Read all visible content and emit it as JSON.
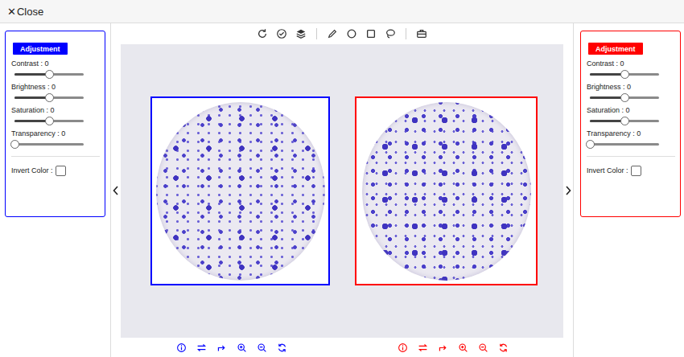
{
  "top_bar": {
    "close_icon": "✕",
    "close_label": "Close"
  },
  "panels": [
    {
      "color": "#0000ff",
      "button": "Adjustment",
      "controls": [
        {
          "kind": "slider",
          "label": "Contrast : 0",
          "level": 0.5
        },
        {
          "kind": "slider",
          "label": "Brightness : 0",
          "level": 0.5
        },
        {
          "kind": "slider",
          "label": "Saturation : 0",
          "level": 0.5
        },
        {
          "kind": "slider",
          "label": "Transparency : 0",
          "level": 0
        },
        {
          "kind": "checkbox",
          "label": "Invert Color :",
          "checked": false
        }
      ]
    },
    {
      "color": "#ff0000",
      "button": "Adjustment",
      "controls": [
        {
          "kind": "slider",
          "label": "Contrast : 0",
          "level": 0.5
        },
        {
          "kind": "slider",
          "label": "Brightness : 0",
          "level": 0.5
        },
        {
          "kind": "slider",
          "label": "Saturation : 0",
          "level": 0.5
        },
        {
          "kind": "slider",
          "label": "Transparency : 0",
          "level": 0
        },
        {
          "kind": "checkbox",
          "label": "Invert Color :",
          "checked": false
        }
      ]
    }
  ],
  "viewers": [
    {
      "color": "#0000ff"
    },
    {
      "color": "#ff0000"
    }
  ]
}
